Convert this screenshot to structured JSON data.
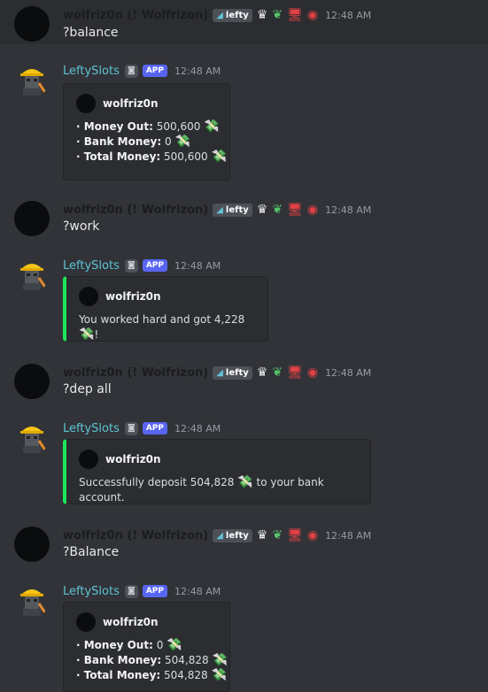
{
  "user": {
    "name": "wolfriz0n (! Wolfrizon)",
    "guild_tag": "lefty",
    "icons": [
      "crown-icon",
      "leaf-icon",
      "monitor-icon",
      "globe-icon"
    ],
    "icon_glyphs": [
      "♛",
      "❦",
      "🖥",
      "◉"
    ]
  },
  "bot": {
    "name": "LeftySlots",
    "app_label": "APP",
    "bot_face": "◙",
    "embed_author": "wolfriz0n",
    "money_emoji": "💸"
  },
  "messages": [
    {
      "time": "12:48 AM",
      "text": "?balance"
    },
    {
      "time": "12:48 AM",
      "lines": [
        {
          "label": "· Money Out:",
          "value": "500,600"
        },
        {
          "label": "· Bank Money:",
          "value": "0"
        },
        {
          "label": "· Total Money:",
          "value": "500,600"
        }
      ]
    },
    {
      "time": "12:48 AM",
      "text": "?work"
    },
    {
      "time": "12:48 AM",
      "pre": "You worked hard and got 4,228",
      "post": "!"
    },
    {
      "time": "12:48 AM",
      "text": "?dep all"
    },
    {
      "time": "12:48 AM",
      "pre": "Successfully deposit 504,828",
      "post": "to your bank account."
    },
    {
      "time": "12:48 AM",
      "text": "?Balance"
    },
    {
      "time": "12:48 AM",
      "lines": [
        {
          "label": "· Money Out:",
          "value": "0"
        },
        {
          "label": "· Bank Money:",
          "value": "504,828"
        },
        {
          "label": "· Total Money:",
          "value": "504,828"
        }
      ]
    }
  ]
}
